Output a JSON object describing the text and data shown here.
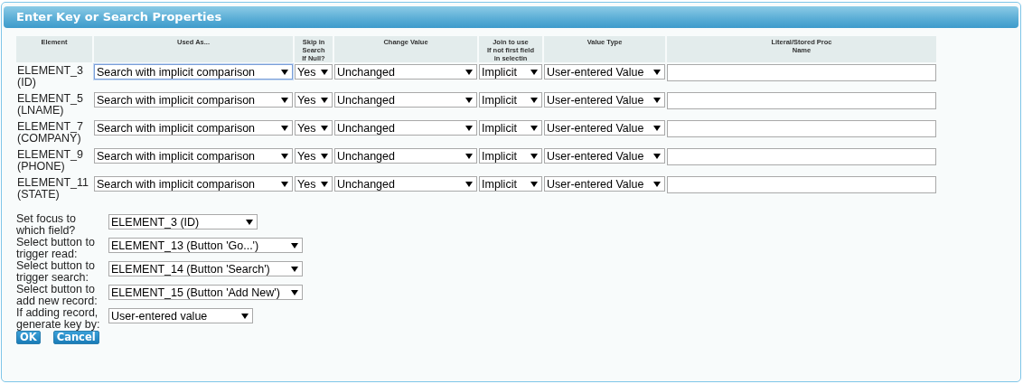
{
  "dialog": {
    "title": "Enter Key or Search Properties"
  },
  "table": {
    "columns": [
      "Element",
      "Used As...",
      "Skip in\nSearch\nIf Null?",
      "Change Value",
      "Join to use\nIf not first field\nin selectin",
      "Value Type",
      "Literal/Stored Proc\nName"
    ],
    "rows": [
      {
        "element": "ELEMENT_3\n(ID)",
        "used_as": {
          "value": "Search with implicit comparison",
          "focused": true
        },
        "skip": "Yes",
        "change": "Unchanged",
        "join": "Implicit",
        "value_type": "User-entered Value"
      },
      {
        "element": "ELEMENT_5\n(LNAME)",
        "used_as": {
          "value": "Search with implicit comparison",
          "focused": false
        },
        "skip": "Yes",
        "change": "Unchanged",
        "join": "Implicit",
        "value_type": "User-entered Value"
      },
      {
        "element": "ELEMENT_7\n(COMPANY)",
        "used_as": {
          "value": "Search with implicit comparison",
          "focused": false
        },
        "skip": "Yes",
        "change": "Unchanged",
        "join": "Implicit",
        "value_type": "User-entered Value"
      },
      {
        "element": "ELEMENT_9\n(PHONE)",
        "used_as": {
          "value": "Search with implicit comparison",
          "focused": false
        },
        "skip": "Yes",
        "change": "Unchanged",
        "join": "Implicit",
        "value_type": "User-entered Value"
      },
      {
        "element": "ELEMENT_11\n(STATE)",
        "used_as": {
          "value": "Search with implicit comparison",
          "focused": false
        },
        "skip": "Yes",
        "change": "Unchanged",
        "join": "Implicit",
        "value_type": "User-entered Value"
      }
    ]
  },
  "settings": [
    {
      "label": "Set focus to\nwhich field?",
      "value": "ELEMENT_3 (ID)"
    },
    {
      "label": "Select button to\ntrigger read:",
      "value": "ELEMENT_13 (Button 'Go...')"
    },
    {
      "label": "Select button to\ntrigger search:",
      "value": "ELEMENT_14 (Button 'Search')"
    },
    {
      "label": "Select button to\nadd new record:",
      "value": "ELEMENT_15 (Button 'Add New')"
    },
    {
      "label": "If adding record,\ngenerate key by:",
      "value": "User-entered value"
    }
  ],
  "buttons": [
    "OK",
    "Cancel"
  ]
}
